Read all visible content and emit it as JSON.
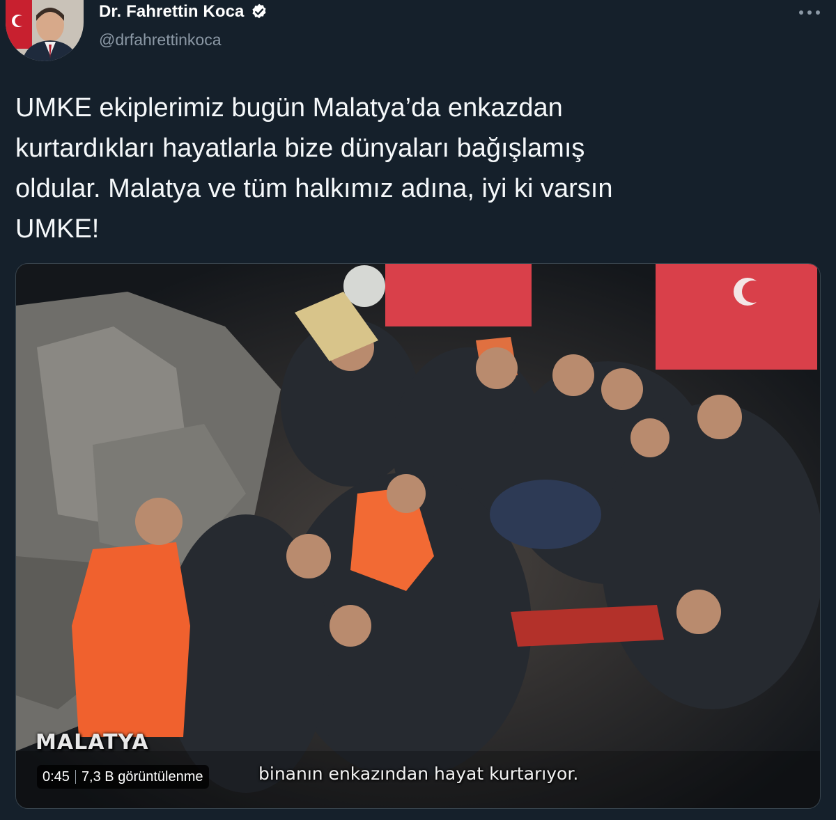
{
  "tweet": {
    "author": {
      "name": "Dr. Fahrettin Koca",
      "handle": "@drfahrettinkoca",
      "verified": true,
      "avatar_icon": "profile-photo"
    },
    "more_icon": "more-horizontal-icon",
    "text_lines": [
      "UMKE ekiplerimiz bugün Malatya’da enkazdan",
      "kurtardıkları hayatlarla bize dünyaları bağışlamış",
      "oldular. Malatya ve tüm halkımız adına, iyi ki varsın",
      "UMKE!"
    ]
  },
  "media": {
    "type": "video",
    "location_caption": "MALATYA",
    "subtitle": "binanın enkazından hayat kurtarıyor.",
    "duration": "0:45",
    "views": "7,3 B görüntülenme"
  },
  "colors": {
    "background": "#15202b",
    "text": "#f5f8fa",
    "secondary_text": "#8b98a5",
    "verified": "#ffffff",
    "flag_red": "#d9404a"
  }
}
